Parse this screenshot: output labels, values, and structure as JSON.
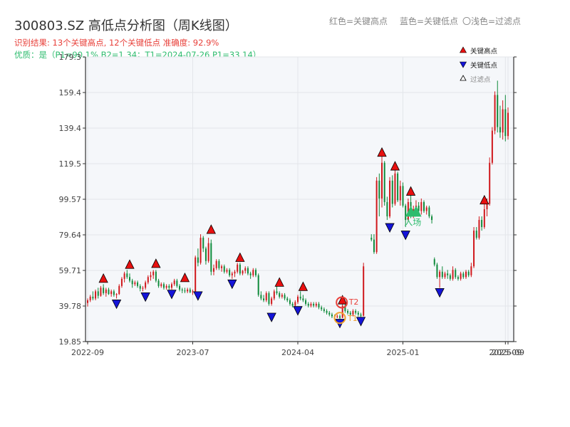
{
  "title": "300803.SZ 高低点分析图（周K线图）",
  "header_legend": {
    "red": "红色=关键高点",
    "blue": "蓝色=关键低点",
    "light": "〇浅色=过滤点"
  },
  "subtitle1": "识别结果: 13个关键高点, 12个关键低点  准确度: 92.9%",
  "subtitle2": "优质：是（P1=90.1%  B2=1.34；T1=2024-07-26 P1=33.14）",
  "legend": {
    "high": "关键高点",
    "low": "关键低点",
    "filtered": "过滤点"
  },
  "colors": {
    "up": "#d0181c",
    "down": "#0f8a3a",
    "high_marker": "#e81010",
    "low_marker": "#1414d8",
    "entry": "#2ebc6e",
    "t1_ring": "#f0a030",
    "t2_ring": "#e8403a",
    "plot_bg": "#f5f7fa"
  },
  "chart_data": {
    "type": "candlestick",
    "ylim": [
      19.85,
      179.3
    ],
    "ytick_labels": [
      "19.85",
      "39.78",
      "59.71",
      "79.64",
      "99.57",
      "119.5",
      "139.4",
      "159.4",
      "179.3"
    ],
    "xtick_labels": [
      "2022-09",
      "2023-07",
      "2024-04",
      "2025-01",
      "2025-09",
      "2025-09"
    ],
    "xtick_positions": [
      0,
      40,
      80,
      120,
      159,
      160
    ],
    "grid": true,
    "legend_position": "top-right",
    "series": [
      {
        "name": "关键高点",
        "points": [
          [
            6,
            52.2
          ],
          [
            16,
            60
          ],
          [
            26,
            60.5
          ],
          [
            37,
            52.6
          ],
          [
            47,
            79.6
          ],
          [
            58,
            63.9
          ],
          [
            73,
            50
          ],
          [
            82,
            47.6
          ],
          [
            97,
            40.1
          ],
          [
            112,
            122.8
          ],
          [
            117,
            115.1
          ],
          [
            123,
            101
          ],
          [
            151,
            96.1
          ]
        ]
      },
      {
        "name": "关键低点",
        "points": [
          [
            11,
            44
          ],
          [
            22,
            48
          ],
          [
            32,
            49.5
          ],
          [
            42,
            48.6
          ],
          [
            55,
            55.2
          ],
          [
            70,
            36.6
          ],
          [
            80,
            40.3
          ],
          [
            96,
            33.2
          ],
          [
            104,
            34.3
          ],
          [
            115,
            86.8
          ],
          [
            121,
            82.6
          ],
          [
            134,
            50.4
          ]
        ]
      },
      {
        "name": "过滤点",
        "points": [
          [
            123,
            90
          ],
          [
            125,
            90
          ]
        ]
      }
    ],
    "annotations": [
      {
        "label": "入场",
        "x": 124,
        "y": 91
      },
      {
        "label": "T1",
        "x": 96,
        "y": 33.1
      },
      {
        "label": "T2",
        "x": 97,
        "y": 41.4
      }
    ],
    "candles": [
      [
        0,
        41.5,
        44,
        39.5,
        43
      ],
      [
        1,
        43,
        46,
        42,
        45
      ],
      [
        2,
        45,
        48,
        43,
        44
      ],
      [
        3,
        44,
        49,
        43,
        48
      ],
      [
        4,
        48,
        50,
        44,
        45.5
      ],
      [
        5,
        45.5,
        51,
        45,
        50
      ],
      [
        6,
        50,
        52,
        46,
        47
      ],
      [
        7,
        47,
        50,
        45,
        49
      ],
      [
        8,
        49,
        50,
        46,
        46.5
      ],
      [
        9,
        46.5,
        49,
        45,
        48
      ],
      [
        10,
        48,
        49,
        45,
        46
      ],
      [
        11,
        46,
        47,
        44,
        46.5
      ],
      [
        12,
        46.5,
        52,
        46,
        51
      ],
      [
        13,
        51,
        56,
        50,
        55
      ],
      [
        14,
        55,
        59,
        53,
        58
      ],
      [
        15,
        58,
        60,
        55,
        56
      ],
      [
        16,
        56,
        58,
        53,
        54
      ],
      [
        17,
        54,
        55,
        50,
        52
      ],
      [
        18,
        52,
        54,
        51,
        53
      ],
      [
        19,
        53,
        54,
        50,
        51
      ],
      [
        20,
        51,
        52,
        48,
        49.5
      ],
      [
        21,
        49.5,
        51,
        48,
        50
      ],
      [
        22,
        50,
        54,
        49,
        53
      ],
      [
        23,
        53,
        57,
        52,
        56
      ],
      [
        24,
        56,
        59,
        54,
        57
      ],
      [
        25,
        57,
        60,
        55,
        59
      ],
      [
        26,
        59,
        60,
        53,
        54
      ],
      [
        27,
        54,
        55,
        50,
        51
      ],
      [
        28,
        51,
        53,
        50,
        52
      ],
      [
        29,
        52,
        53,
        49,
        50
      ],
      [
        30,
        50,
        52,
        49,
        51
      ],
      [
        31,
        51,
        52,
        49,
        50
      ],
      [
        32,
        50,
        53,
        49,
        52
      ],
      [
        33,
        52,
        55,
        51,
        54
      ],
      [
        34,
        54,
        55,
        50,
        51
      ],
      [
        35,
        51,
        52,
        48,
        49
      ],
      [
        36,
        49,
        50,
        47,
        48.5
      ],
      [
        37,
        48.5,
        50,
        47,
        48
      ],
      [
        38,
        48,
        50,
        47,
        49
      ],
      [
        39,
        49,
        50,
        47,
        47.5
      ],
      [
        40,
        47.5,
        49,
        46,
        48
      ],
      [
        41,
        48,
        68,
        47.5,
        67
      ],
      [
        42,
        67,
        72,
        62,
        64
      ],
      [
        43,
        64,
        80,
        63,
        78
      ],
      [
        44,
        78,
        79,
        70,
        72
      ],
      [
        45,
        72,
        73,
        63,
        65
      ],
      [
        46,
        65,
        78,
        64,
        75
      ],
      [
        47,
        75,
        77,
        57,
        59
      ],
      [
        48,
        59,
        63,
        57,
        61
      ],
      [
        49,
        61,
        66,
        60,
        65
      ],
      [
        50,
        65,
        66,
        60,
        61
      ],
      [
        51,
        61,
        63,
        59,
        62
      ],
      [
        52,
        62,
        63,
        58,
        59
      ],
      [
        53,
        59,
        61,
        58,
        60
      ],
      [
        54,
        60,
        61,
        56,
        57
      ],
      [
        55,
        57,
        59,
        55,
        58
      ],
      [
        56,
        58,
        60,
        56,
        59
      ],
      [
        57,
        59,
        64,
        58,
        63
      ],
      [
        58,
        63,
        64,
        57,
        58
      ],
      [
        59,
        58,
        60,
        57,
        59.5
      ],
      [
        60,
        59.5,
        62,
        58,
        61
      ],
      [
        61,
        61,
        62,
        57,
        58
      ],
      [
        62,
        58,
        59,
        55,
        57
      ],
      [
        63,
        57,
        61,
        56,
        60
      ],
      [
        64,
        60,
        61,
        56,
        57
      ],
      [
        65,
        57,
        58,
        45,
        46
      ],
      [
        66,
        46,
        48,
        43,
        44
      ],
      [
        67,
        44,
        46,
        42,
        43
      ],
      [
        68,
        43,
        48,
        42,
        47
      ],
      [
        69,
        47,
        48,
        40,
        41
      ],
      [
        70,
        41,
        45,
        40,
        44
      ],
      [
        71,
        44,
        49,
        43,
        48
      ],
      [
        72,
        48,
        51,
        46,
        47
      ],
      [
        73,
        47,
        48,
        44,
        45
      ],
      [
        74,
        45,
        47,
        44,
        46
      ],
      [
        75,
        46,
        47,
        43,
        44
      ],
      [
        76,
        44,
        45,
        42,
        43
      ],
      [
        77,
        43,
        44,
        40,
        41
      ],
      [
        78,
        41,
        42,
        39,
        40
      ],
      [
        79,
        40,
        43,
        39,
        42
      ],
      [
        80,
        42,
        46,
        41,
        45
      ],
      [
        81,
        45,
        48,
        43,
        44
      ],
      [
        82,
        44,
        46,
        42,
        43
      ],
      [
        83,
        43,
        44,
        40,
        41
      ],
      [
        84,
        41,
        42,
        39,
        40
      ],
      [
        85,
        40,
        42,
        39,
        41
      ],
      [
        86,
        41,
        42,
        39,
        40
      ],
      [
        87,
        40,
        42,
        39,
        41
      ],
      [
        88,
        41,
        42,
        38,
        39
      ],
      [
        89,
        39,
        40,
        37,
        38
      ],
      [
        90,
        38,
        39,
        36,
        37
      ],
      [
        91,
        37,
        38,
        35,
        36
      ],
      [
        92,
        36,
        37,
        34,
        35
      ],
      [
        93,
        35,
        36,
        33,
        34
      ],
      [
        94,
        34,
        35,
        33,
        33.5
      ],
      [
        95,
        33.5,
        35,
        33,
        34
      ],
      [
        96,
        34,
        35,
        32,
        33.2
      ],
      [
        97,
        33.2,
        41,
        33,
        40
      ],
      [
        98,
        40,
        41,
        36,
        37
      ],
      [
        99,
        37,
        38,
        35,
        36
      ],
      [
        100,
        36,
        37,
        34,
        35
      ],
      [
        101,
        35,
        38,
        34,
        37
      ],
      [
        102,
        37,
        38,
        35,
        36
      ],
      [
        103,
        36,
        37,
        34,
        35
      ],
      [
        104,
        35,
        36,
        33,
        34.3
      ],
      [
        105,
        34.3,
        64,
        34,
        62
      ],
      [
        108,
        78,
        80,
        76,
        77
      ],
      [
        109,
        77,
        80,
        69,
        70
      ],
      [
        110,
        70,
        112,
        69,
        110
      ],
      [
        111,
        110,
        114,
        90,
        100
      ],
      [
        112,
        100,
        124,
        95,
        120
      ],
      [
        113,
        120,
        121,
        96,
        98
      ],
      [
        114,
        98,
        101,
        88,
        90
      ],
      [
        115,
        90,
        112,
        89,
        110
      ],
      [
        116,
        110,
        113,
        95,
        97
      ],
      [
        117,
        97,
        116,
        96,
        114
      ],
      [
        118,
        114,
        115,
        98,
        99
      ],
      [
        119,
        99,
        110,
        96,
        107
      ],
      [
        120,
        107,
        109,
        95,
        96
      ],
      [
        121,
        96,
        97,
        84,
        88
      ],
      [
        122,
        88,
        100,
        87,
        98
      ],
      [
        123,
        98,
        102,
        89,
        91
      ],
      [
        124,
        91,
        96,
        89,
        94
      ],
      [
        125,
        94,
        99,
        92,
        96
      ],
      [
        126,
        96,
        98,
        91,
        93
      ],
      [
        127,
        93,
        100,
        91,
        98
      ],
      [
        128,
        98,
        99,
        92,
        93
      ],
      [
        129,
        93,
        96,
        91,
        95
      ],
      [
        130,
        95,
        96,
        89,
        90
      ],
      [
        131,
        90,
        91,
        86,
        88
      ],
      [
        132,
        66,
        67,
        62,
        63
      ],
      [
        133,
        63,
        64,
        55,
        56
      ],
      [
        134,
        56,
        60,
        50,
        59
      ],
      [
        135,
        59,
        62,
        55,
        56
      ],
      [
        136,
        56,
        59,
        55,
        58
      ],
      [
        137,
        58,
        60,
        55,
        57
      ],
      [
        138,
        57,
        58,
        54,
        55
      ],
      [
        139,
        55,
        62,
        54,
        60
      ],
      [
        140,
        60,
        61,
        55,
        56
      ],
      [
        141,
        56,
        57,
        54,
        55
      ],
      [
        142,
        55,
        59,
        54,
        58
      ],
      [
        143,
        58,
        59,
        55,
        56
      ],
      [
        144,
        56,
        60,
        55,
        59
      ],
      [
        145,
        59,
        60,
        56,
        57
      ],
      [
        146,
        57,
        64,
        56,
        62
      ],
      [
        147,
        62,
        84,
        61,
        82
      ],
      [
        148,
        82,
        84,
        77,
        78
      ],
      [
        149,
        78,
        90,
        77,
        88
      ],
      [
        150,
        88,
        90,
        82,
        84
      ],
      [
        151,
        84,
        97,
        83,
        94
      ],
      [
        152,
        94,
        100,
        90,
        97
      ],
      [
        153,
        97,
        123,
        96,
        120
      ],
      [
        154,
        120,
        140,
        119,
        138
      ],
      [
        155,
        138,
        160,
        136,
        158
      ],
      [
        156,
        158,
        166,
        137,
        140
      ],
      [
        157,
        140,
        152,
        134,
        137
      ],
      [
        158,
        137,
        155,
        133,
        150
      ],
      [
        159,
        150,
        158,
        132,
        135
      ],
      [
        160,
        135,
        151,
        133,
        148
      ]
    ]
  }
}
